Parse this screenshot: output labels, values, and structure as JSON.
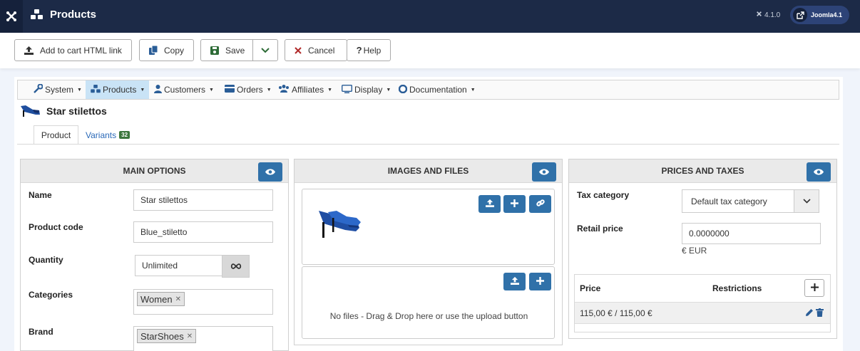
{
  "header": {
    "title": "Products",
    "version": "4.1.0",
    "site_label": "Joomla4.1"
  },
  "toolbar": {
    "add_to_cart_label": "Add to cart HTML link",
    "copy_label": "Copy",
    "save_label": "Save",
    "cancel_label": "Cancel",
    "help_label": "Help"
  },
  "submenu": {
    "items": [
      {
        "label": "System",
        "icon": "wrench-icon"
      },
      {
        "label": "Products",
        "icon": "cubes-icon"
      },
      {
        "label": "Customers",
        "icon": "user-icon"
      },
      {
        "label": "Orders",
        "icon": "credit-card-icon"
      },
      {
        "label": "Affiliates",
        "icon": "users-icon"
      },
      {
        "label": "Display",
        "icon": "monitor-icon"
      },
      {
        "label": "Documentation",
        "icon": "lifebuoy-icon"
      }
    ]
  },
  "product": {
    "title": "Star stilettos"
  },
  "tabs": {
    "product": "Product",
    "variants": "Variants",
    "variants_count": "32"
  },
  "main_options": {
    "heading": "MAIN OPTIONS",
    "name_label": "Name",
    "name_value": "Star stilettos",
    "code_label": "Product code",
    "code_value": "Blue_stiletto",
    "quantity_label": "Quantity",
    "quantity_value": "Unlimited",
    "categories_label": "Categories",
    "category_tag": "Women",
    "brand_label": "Brand",
    "brand_tag": "StarShoes"
  },
  "images_files": {
    "heading": "IMAGES AND FILES",
    "no_files_text": "No files - Drag & Drop here or use the upload button"
  },
  "prices_taxes": {
    "heading": "PRICES AND TAXES",
    "tax_category_label": "Tax category",
    "tax_category_value": "Default tax category",
    "retail_price_label": "Retail price",
    "retail_price_value": "0.0000000",
    "currency_note": "€ EUR",
    "price_col": "Price",
    "restrictions_col": "Restrictions",
    "price_row_value": "115,00 € / 115,00 €"
  },
  "colors": {
    "header_bg": "#1c2a47",
    "accent_blue": "#3071a9",
    "submenu_active": "#c9e3f6",
    "badge_green": "#3c763d"
  }
}
